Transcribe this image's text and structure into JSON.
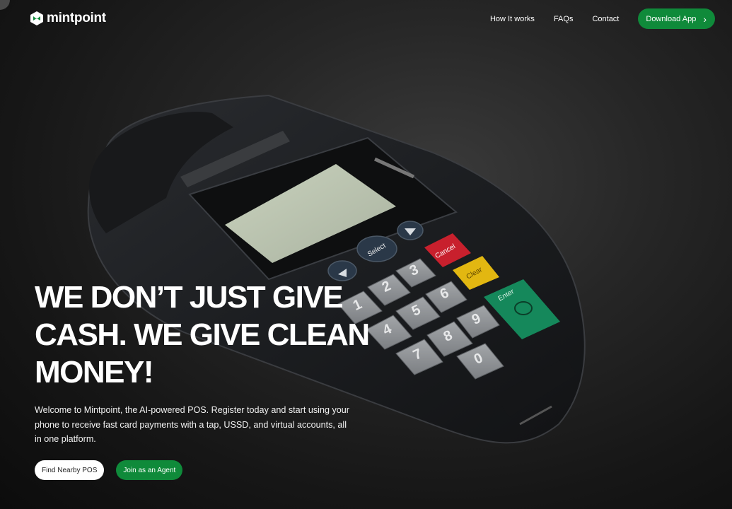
{
  "brand": {
    "name": "mintpoint",
    "accent_color": "#0f8a3a"
  },
  "nav": {
    "links": [
      "How It works",
      "FAQs",
      "Contact"
    ],
    "download_label": "Download App",
    "download_icon": "chevron-right-icon"
  },
  "hero": {
    "headline_lines": [
      "WE DON’T JUST GIVE",
      "CASH. WE GIVE CLEAN",
      "MONEY!"
    ],
    "subtitle": "Welcome to Mintpoint, the AI-powered POS. Register today and start using your phone to receive fast card payments with a tap, USSD, and virtual accounts, all in one platform.",
    "buttons": {
      "find_pos": "Find Nearby POS",
      "join_agent": "Join as an Agent"
    }
  },
  "pos_terminal": {
    "keys": [
      "1",
      "2",
      "3",
      "4",
      "5",
      "6",
      "7",
      "8",
      "9",
      "0"
    ],
    "select": "Select",
    "cancel": "Cancel",
    "clear": "Clear",
    "enter": "Enter"
  }
}
